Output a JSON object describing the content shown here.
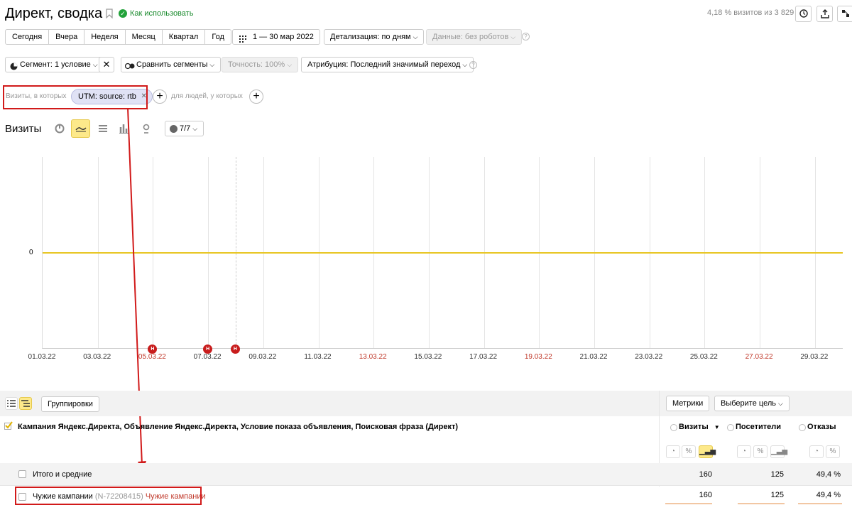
{
  "header": {
    "title": "Директ, сводка",
    "how_to_use": "Как использовать",
    "visits_share": "4,18 % визитов из 3 829"
  },
  "period_buttons": [
    "Сегодня",
    "Вчера",
    "Неделя",
    "Месяц",
    "Квартал",
    "Год"
  ],
  "date_range": "1 — 30 мар 2022",
  "detail": "Детализация: по дням",
  "data_filter": "Данные: без роботов",
  "segment": "Сегмент: 1 условие",
  "compare": "Сравнить сегменты",
  "accuracy": "Точность: 100%",
  "attribution": "Атрибуция: Последний значимый переход",
  "filter": {
    "visits_label": "Визиты, в которых",
    "utm_chip": "UTM: source: rtb",
    "people_label": "для людей, у которых"
  },
  "chart_header": {
    "title": "Визиты",
    "series_count": "7/7"
  },
  "chart_data": {
    "type": "line",
    "x": [
      "01.03.22",
      "03.03.22",
      "05.03.22",
      "07.03.22",
      "09.03.22",
      "11.03.22",
      "13.03.22",
      "15.03.22",
      "17.03.22",
      "19.03.22",
      "21.03.22",
      "23.03.22",
      "25.03.22",
      "27.03.22",
      "29.03.22"
    ],
    "red_labels": [
      "05.03.22",
      "13.03.22",
      "19.03.22",
      "27.03.22"
    ],
    "y_tick": "0",
    "series": [
      {
        "color": "#e8c624",
        "values": [
          0,
          0,
          0,
          0,
          0,
          0,
          0,
          0,
          0,
          0,
          0,
          0,
          0,
          0,
          0
        ]
      }
    ],
    "markers": [
      {
        "label": "H",
        "date": "05.03.22"
      },
      {
        "label": "H",
        "date": "07.03.22"
      },
      {
        "label": "H",
        "date": "08.03.22"
      }
    ]
  },
  "table": {
    "groupings_btn": "Группировки",
    "metrics_btn": "Метрики",
    "goal_btn": "Выберите цель",
    "dimension_header": "Кампания Яндекс.Директа, Объявление Яндекс.Директа, Условие показа объявления, Поисковая фраза (Директ)",
    "columns": [
      "Визиты",
      "Посетители",
      "Отказы"
    ],
    "sort_marker": "▼",
    "totals": {
      "label": "Итого и средние",
      "visits": "160",
      "visitors": "125",
      "bounce": "49,4 %"
    },
    "rows": [
      {
        "label": "Чужие кампании",
        "id": "(N-72208415)",
        "link": "Чужие кампании",
        "visits": "160",
        "visitors": "125",
        "bounce": "49,4 %"
      }
    ]
  },
  "colors": {
    "accent": "#fde98a",
    "annotation": "#d11a1a",
    "series": "#e8c624"
  }
}
